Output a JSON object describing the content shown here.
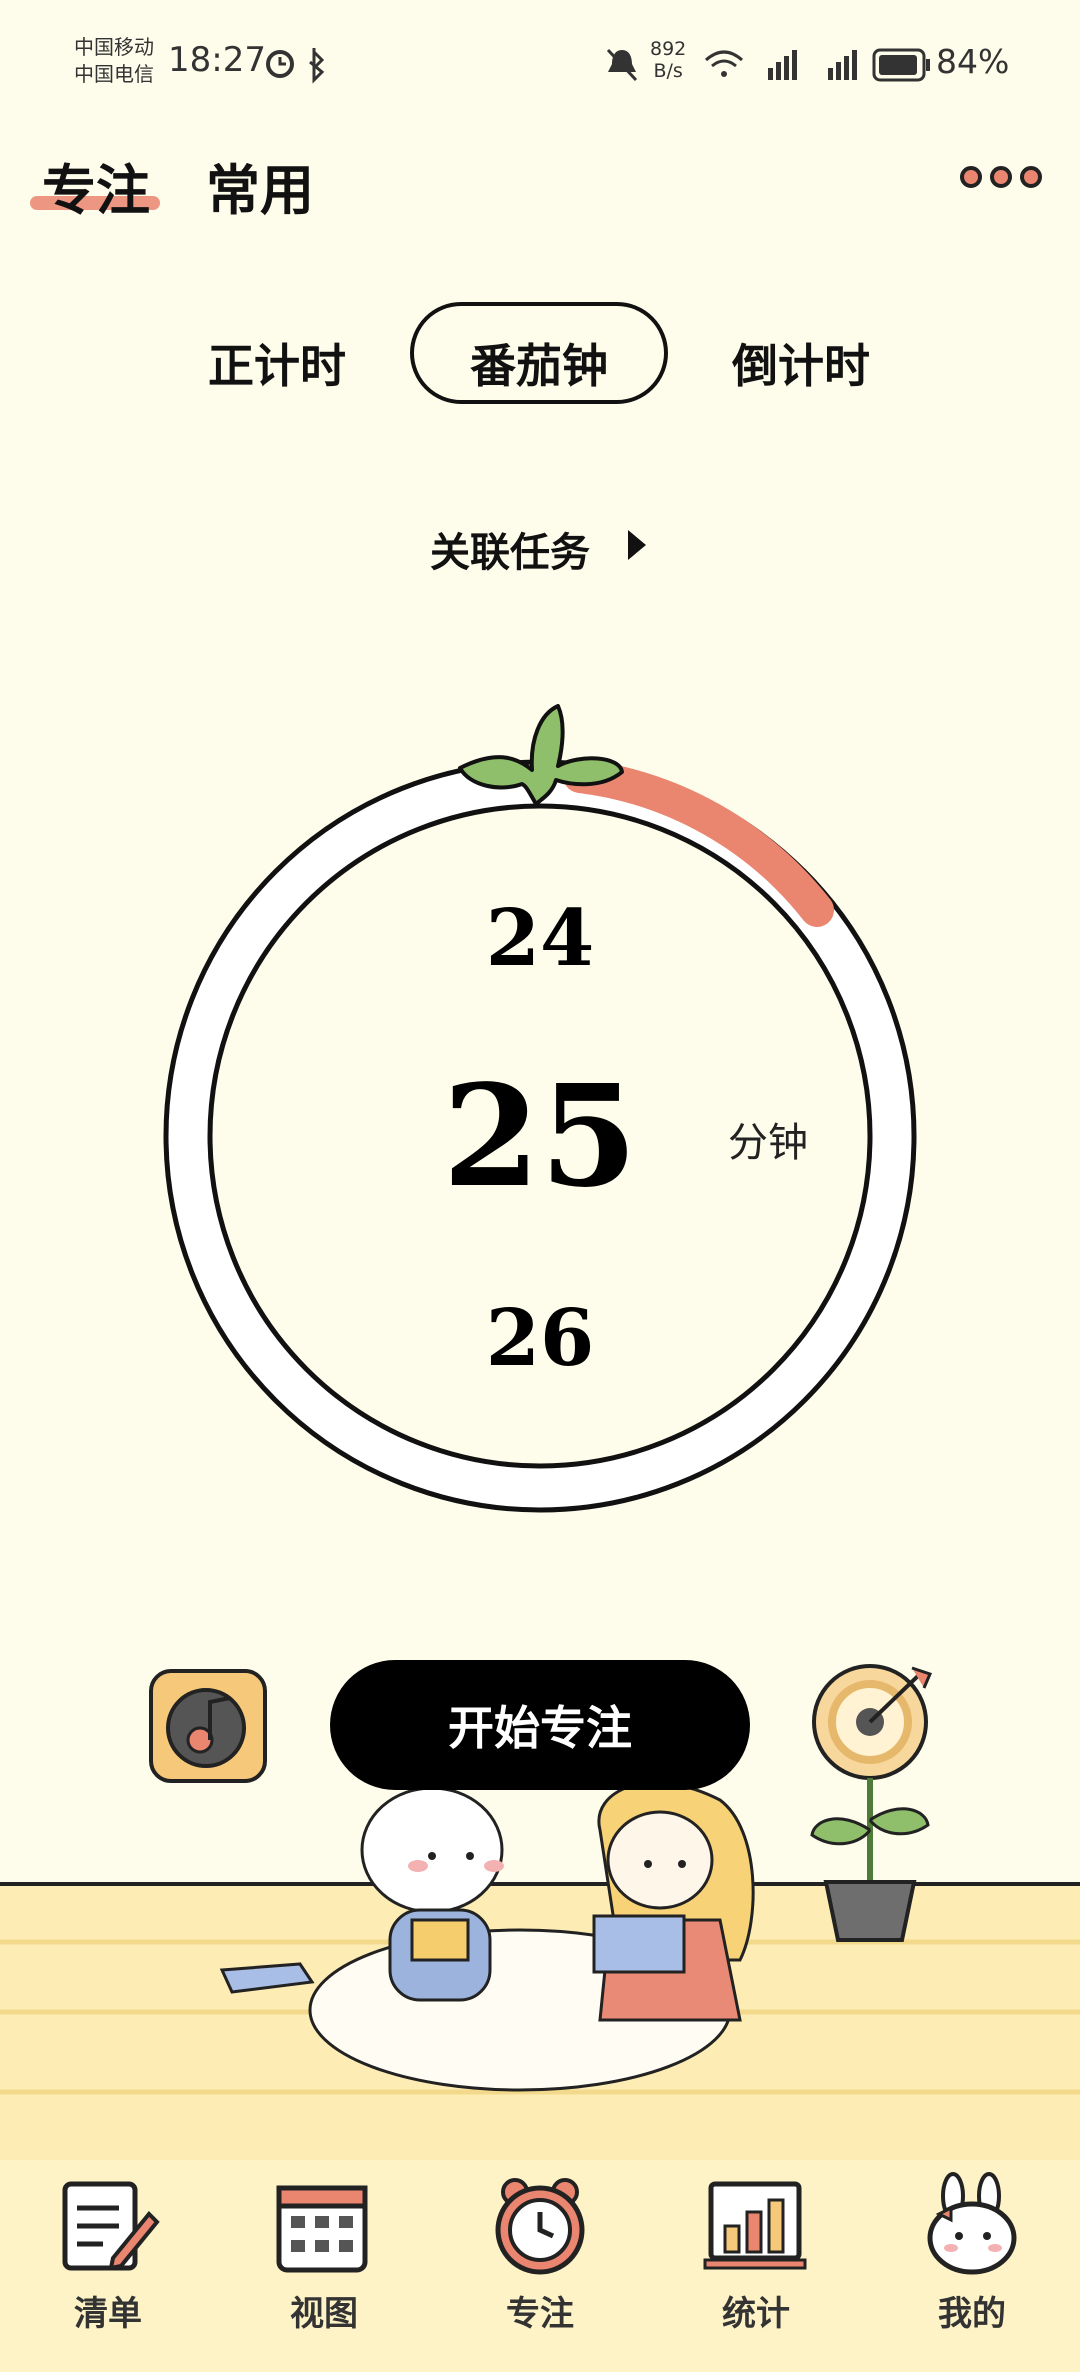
{
  "status_bar": {
    "carrier_1": "中国移动",
    "carrier_2": "中国电信",
    "time": "18:27",
    "net_speed_value": "892",
    "net_speed_unit": "B/s",
    "battery": "84%"
  },
  "header": {
    "tabs": [
      {
        "label": "专注"
      },
      {
        "label": "常用"
      }
    ]
  },
  "modes": [
    {
      "label": "正计时"
    },
    {
      "label": "番茄钟"
    },
    {
      "label": "倒计时"
    }
  ],
  "task_link": {
    "label": "关联任务"
  },
  "timer": {
    "prev": "24",
    "value": "25",
    "next": "26",
    "unit": "分钟"
  },
  "actions": {
    "start_label": "开始专注"
  },
  "bottom_nav": [
    {
      "label": "清单"
    },
    {
      "label": "视图"
    },
    {
      "label": "专注"
    },
    {
      "label": "统计"
    },
    {
      "label": "我的"
    }
  ],
  "colors": {
    "background": "#FEFDEB",
    "accent": "#EA8570",
    "leaf": "#8FBF6A",
    "button": "#000000"
  }
}
